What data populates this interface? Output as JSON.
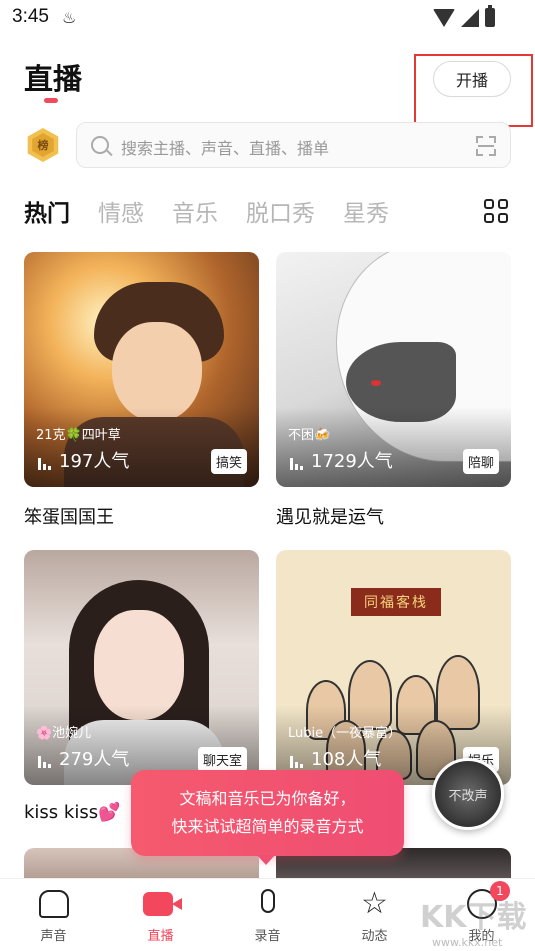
{
  "status_bar": {
    "time": "3:45"
  },
  "header": {
    "title": "直播",
    "live_button": "开播"
  },
  "search": {
    "rank_badge": "榜",
    "placeholder": "搜索主播、声音、直播、播单"
  },
  "tabs": [
    "热门",
    "情感",
    "音乐",
    "脱口秀",
    "星秀"
  ],
  "cards": [
    {
      "title": "笨蛋国国王",
      "host": "21克🍀四叶草",
      "popularity": "197人气",
      "tag": "搞笑"
    },
    {
      "title": "遇见就是运气",
      "host": "不困🍻",
      "popularity": "1729人气",
      "tag": "陪聊"
    },
    {
      "title": "kiss kiss💕",
      "host": "🌸池婉儿",
      "popularity": "279人气",
      "tag": "聊天室"
    },
    {
      "title": "",
      "host": "Lubie（一夜暴富）",
      "popularity": "108人气",
      "tag": "娱乐",
      "sign": "同福客栈"
    }
  ],
  "tooltip": {
    "line1": "文稿和音乐已为你备好，",
    "line2": "快来试试超简单的录音方式"
  },
  "floating_avatar": {
    "label": "不改声"
  },
  "bottom_nav": [
    {
      "label": "声音",
      "icon": "sound-icon"
    },
    {
      "label": "直播",
      "icon": "live-camera-icon"
    },
    {
      "label": "录音",
      "icon": "mic-icon"
    },
    {
      "label": "动态",
      "icon": "star-icon"
    },
    {
      "label": "我的",
      "icon": "profile-icon",
      "badge": "1"
    }
  ],
  "watermark": {
    "text": "KK下载",
    "url": "www.kkx.net"
  },
  "colors": {
    "accent": "#f2475c",
    "highlight_box": "#e53935"
  }
}
